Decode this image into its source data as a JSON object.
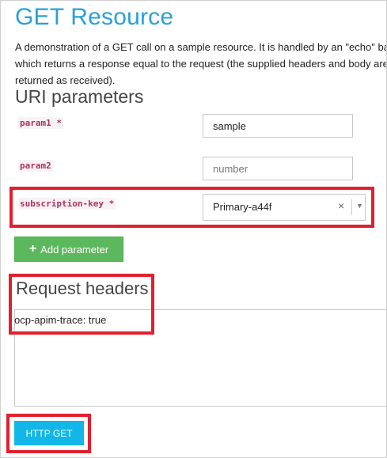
{
  "page": {
    "title": "GET Resource",
    "description": "A demonstration of a GET call on a sample resource. It is handled by an \"echo\" backend which returns a response equal to the request (the supplied headers and body are being returned as received)."
  },
  "uri_parameters": {
    "title": "URI parameters",
    "params": [
      {
        "label": "param1",
        "required_mark": "*",
        "value": "sample",
        "placeholder": ""
      },
      {
        "label": "param2",
        "required_mark": "",
        "value": "",
        "placeholder": "number"
      }
    ],
    "subscription_key": {
      "label": "subscription-key",
      "required_mark": "*",
      "selected": "Primary-a44f",
      "clear_glyph": "×",
      "dropdown_glyph": "▼"
    },
    "add_button": {
      "icon": "plus-icon",
      "label": "Add parameter"
    }
  },
  "request_headers": {
    "title": "Request headers",
    "value": "ocp-apim-trace: true"
  },
  "actions": {
    "send_label": "HTTP GET"
  },
  "colors": {
    "title": "#2aa0d8",
    "param_label": "#b3305a",
    "add_button": "#5cb85c",
    "get_button": "#12b6e8",
    "highlight_box": "#e0202e"
  }
}
